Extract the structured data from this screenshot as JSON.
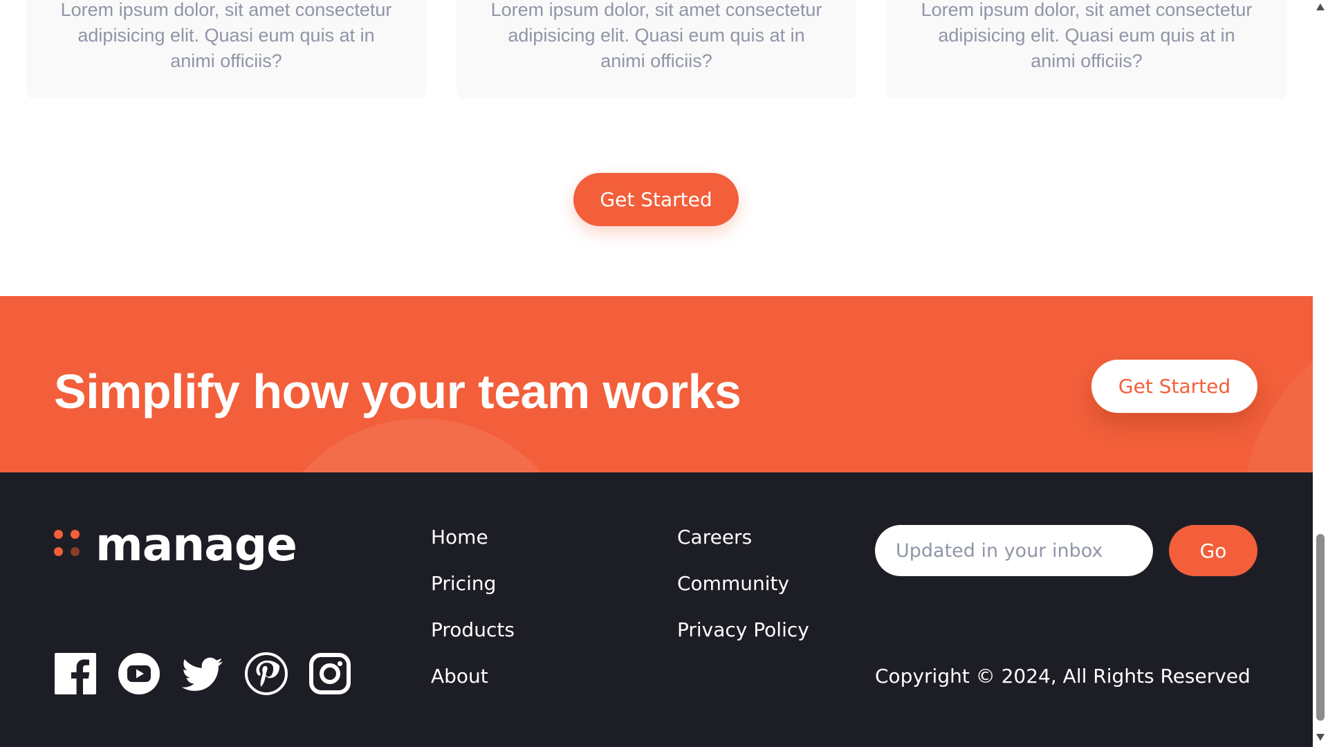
{
  "cards": [
    {
      "text": "Lorem ipsum dolor, sit amet consectetur adipisicing elit. Quasi eum quis at in animi officiis?"
    },
    {
      "text": "Lorem ipsum dolor, sit amet consectetur adipisicing elit. Quasi eum quis at in animi officiis?"
    },
    {
      "text": "Lorem ipsum dolor, sit amet consectetur adipisicing elit. Quasi eum quis at in animi officiis?"
    }
  ],
  "cta": {
    "label": "Get Started"
  },
  "banner": {
    "title": "Simplify how your team works",
    "button_label": "Get Started"
  },
  "footer": {
    "logo_text": "manage",
    "socials": [
      {
        "icon": "facebook-icon"
      },
      {
        "icon": "youtube-icon"
      },
      {
        "icon": "twitter-icon"
      },
      {
        "icon": "pinterest-icon"
      },
      {
        "icon": "instagram-icon"
      }
    ],
    "nav_col_1": [
      "Home",
      "Pricing",
      "Products",
      "About"
    ],
    "nav_col_2": [
      "Careers",
      "Community",
      "Privacy Policy"
    ],
    "newsletter": {
      "placeholder": "Updated in your inbox",
      "button_label": "Go"
    },
    "copyright": "Copyright © 2024, All Rights Reserved"
  },
  "colors": {
    "accent": "#f25f3a",
    "footer_bg": "#1d1e25",
    "card_bg": "#f9f9f9",
    "muted_text": "#9095a7"
  }
}
